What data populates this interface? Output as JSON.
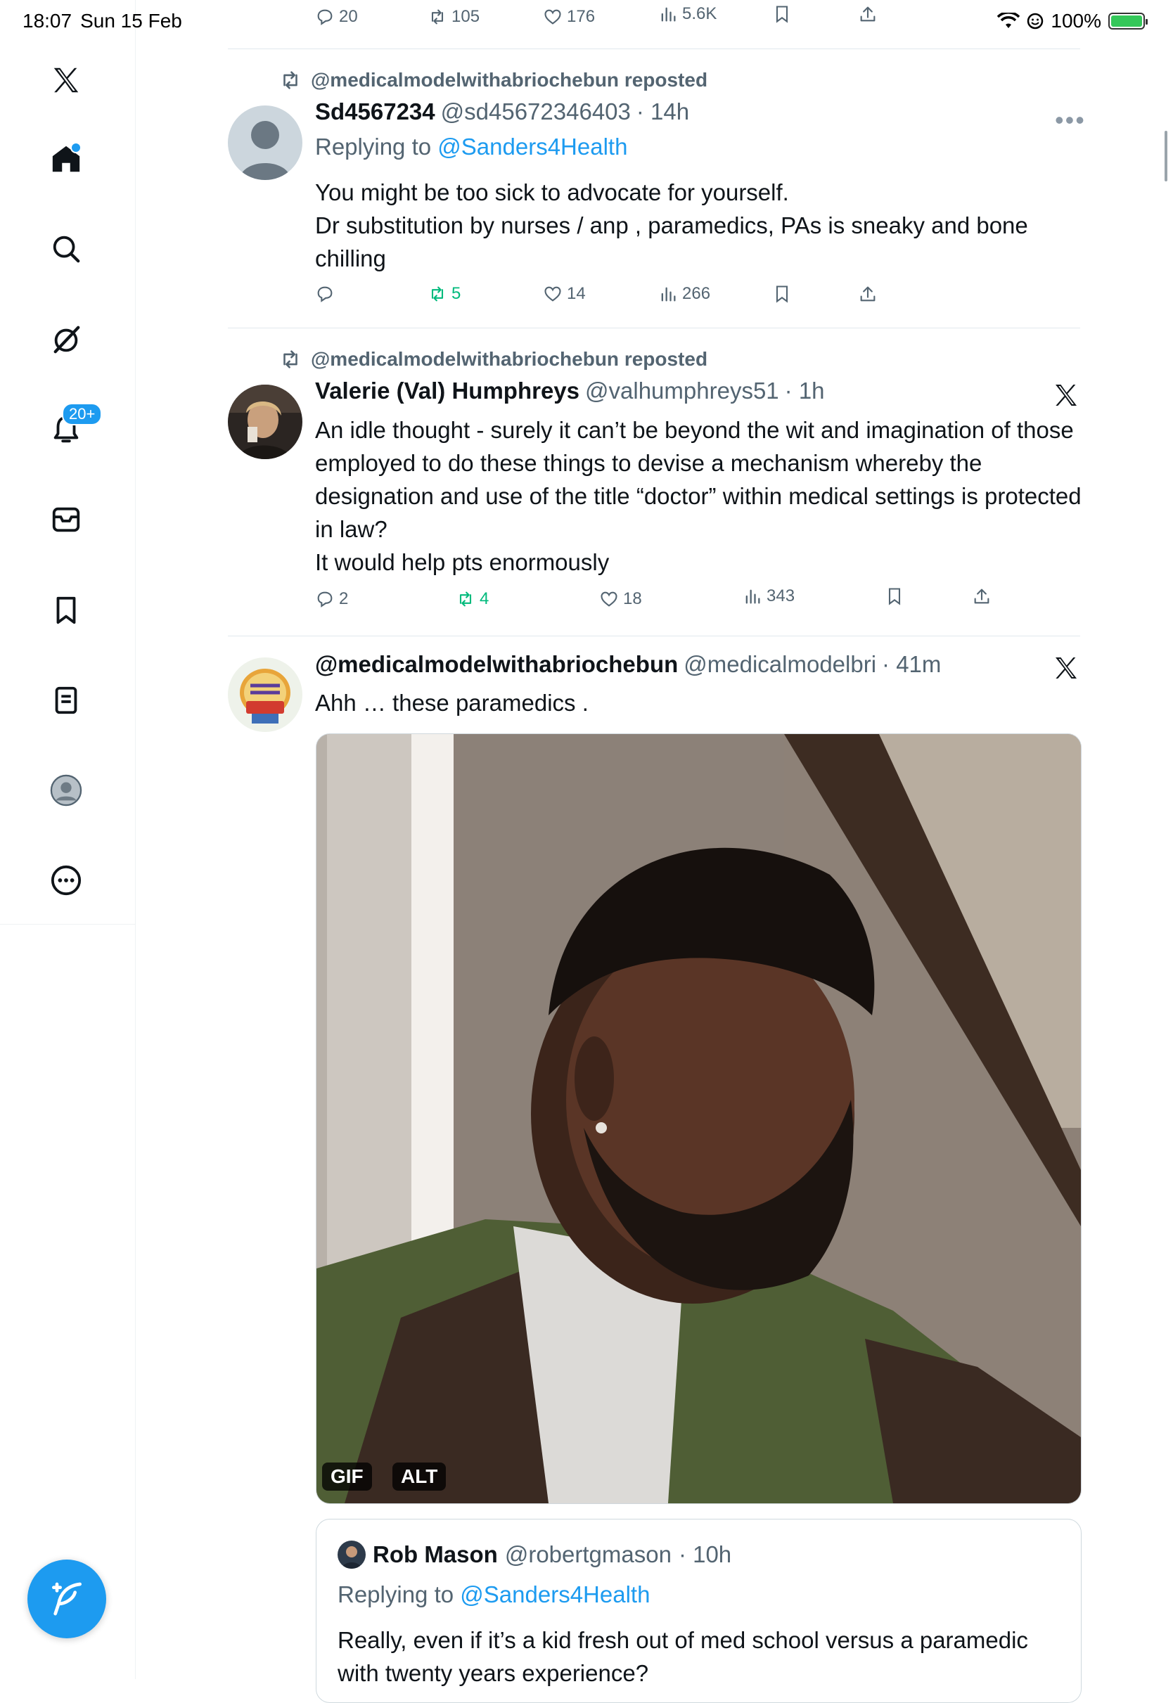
{
  "status_bar": {
    "time": "18:07",
    "date": "Sun 15 Feb",
    "battery": "100%"
  },
  "sidebar": {
    "notifications_badge": "20+",
    "items": [
      "X",
      "Home",
      "Search",
      "Grok",
      "Notifications",
      "Messages",
      "Bookmarks",
      "Lists",
      "Profile",
      "More"
    ]
  },
  "top_actions": {
    "replies": "20",
    "reposts": "105",
    "likes": "176",
    "views": "5.6K"
  },
  "tweets": [
    {
      "repost_label": "@medicalmodelwithabriochebun reposted",
      "name": "Sd4567234",
      "handle": "@sd45672346403",
      "time": "· 14h",
      "reply_prefix": "Replying to",
      "reply_to": "@Sanders4Health",
      "text": "You might be too sick to advocate for yourself.\nDr substitution by nurses / anp , paramedics, PAs is sneaky and bone chilling",
      "actions": {
        "replies": "",
        "reposts": "5",
        "likes": "14",
        "views": "266"
      }
    },
    {
      "repost_label": "@medicalmodelwithabriochebun reposted",
      "name": "Valerie (Val) Humphreys",
      "handle": "@valhumphreys51",
      "time": "· 1h",
      "text": "An idle thought - surely it can’t be beyond the wit and imagination of those employed to do these things to devise a mechanism whereby the designation and use of the title “doctor” within medical settings is protected in law?\nIt would help pts enormously",
      "actions": {
        "replies": "2",
        "reposts": "4",
        "likes": "18",
        "views": "343"
      }
    },
    {
      "name": "@medicalmodelwithabriochebun",
      "handle": "@medicalmodelbri",
      "time": "· 41m",
      "text": "Ahh … these paramedics .",
      "media_tags": [
        "GIF",
        "ALT"
      ],
      "quote": {
        "name": "Rob Mason",
        "handle": "@robertgmason",
        "time": "· 10h",
        "reply_prefix": "Replying to",
        "reply_to": "@Sanders4Health",
        "text": "Really, even if it’s a kid fresh out of med school versus a paramedic with twenty years experience?"
      }
    }
  ],
  "colors": {
    "accent": "#1d9bf0",
    "repost_green": "#00ba7c",
    "muted": "#536471"
  }
}
